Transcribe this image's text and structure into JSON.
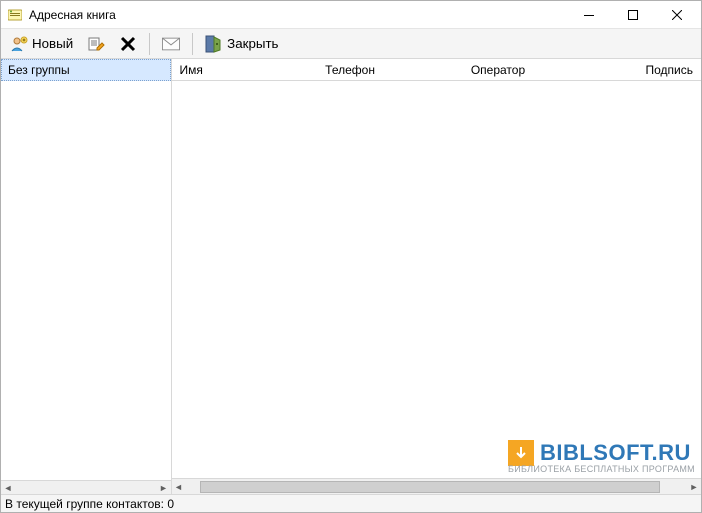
{
  "window": {
    "title": "Адресная книга"
  },
  "toolbar": {
    "new_label": "Новый",
    "close_label": "Закрыть"
  },
  "sidebar": {
    "groups": [
      {
        "label": "Без группы",
        "selected": true
      }
    ]
  },
  "columns": {
    "name": "Имя",
    "phone": "Телефон",
    "operator": "Оператор",
    "signature": "Подпись"
  },
  "rows": [],
  "status": {
    "text_prefix": "В текущей группе контактов:",
    "count": 0
  },
  "watermark": {
    "title": "BIBLSOFT.RU",
    "subtitle": "БИБЛИОТЕКА БЕСПЛАТНЫХ ПРОГРАММ"
  }
}
